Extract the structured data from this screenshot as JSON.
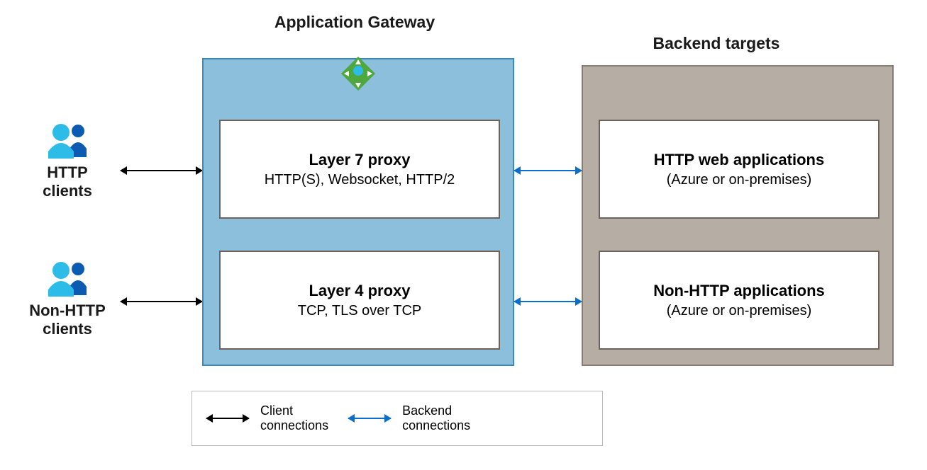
{
  "titles": {
    "gateway": "Application Gateway",
    "backend": "Backend targets"
  },
  "clients": {
    "http": {
      "label": "HTTP clients"
    },
    "nonhttp": {
      "label": "Non-HTTP clients"
    }
  },
  "gateway": {
    "layer7": {
      "title": "Layer 7 proxy",
      "subtitle": "HTTP(S), Websocket, HTTP/2"
    },
    "layer4": {
      "title": "Layer 4 proxy",
      "subtitle": "TCP, TLS over TCP"
    }
  },
  "backend": {
    "http": {
      "title": "HTTP web applications",
      "subtitle": "(Azure or on-premises)"
    },
    "nonhttp": {
      "title": "Non-HTTP applications",
      "subtitle": "(Azure or on-premises)"
    }
  },
  "legend": {
    "client": "Client connections",
    "backend": "Backend connections"
  },
  "colors": {
    "gateway_bg": "#8bbfdc",
    "backend_bg": "#b6ada5",
    "arrow_client": "#000000",
    "arrow_backend": "#0b6ecf"
  }
}
